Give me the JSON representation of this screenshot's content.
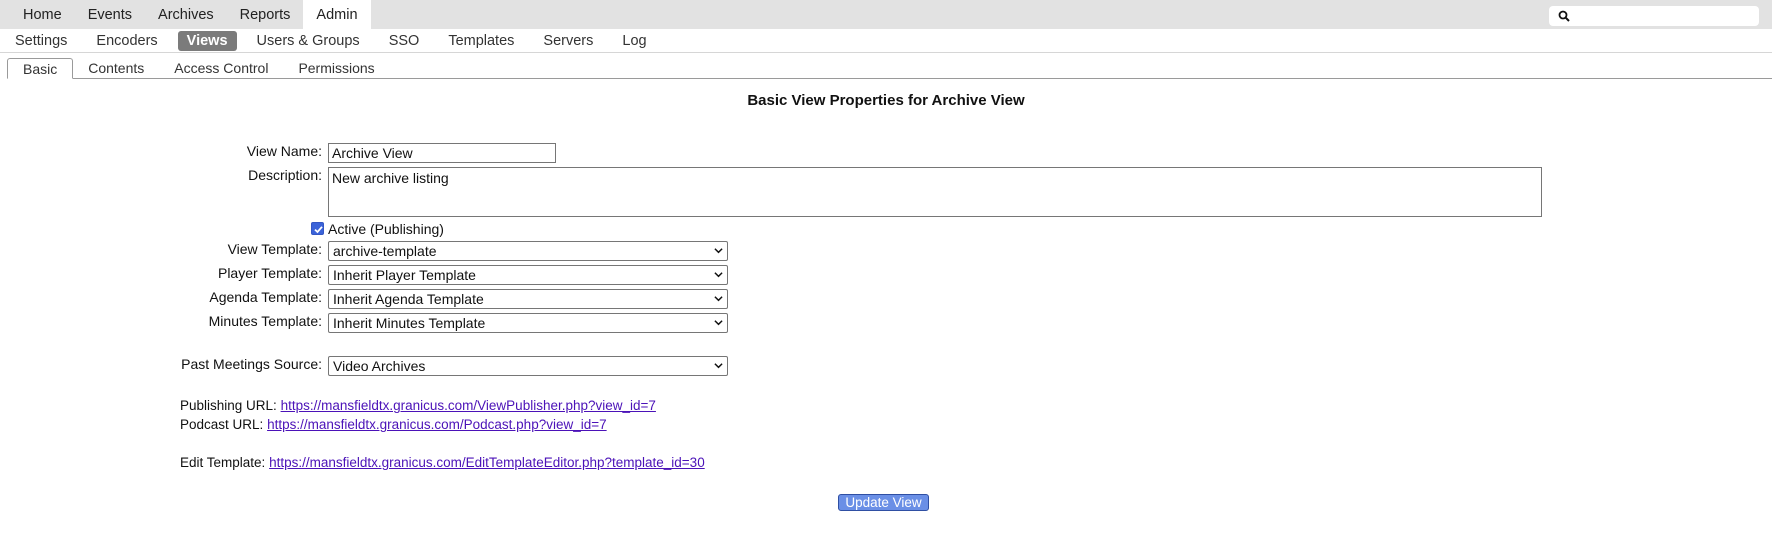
{
  "top_nav": {
    "tabs": [
      {
        "label": "Home"
      },
      {
        "label": "Events"
      },
      {
        "label": "Archives"
      },
      {
        "label": "Reports"
      },
      {
        "label": "Admin",
        "active": true
      }
    ],
    "search": {
      "value": "",
      "icon": "search-icon"
    }
  },
  "sub_nav": {
    "items": [
      {
        "label": "Settings"
      },
      {
        "label": "Encoders"
      },
      {
        "label": "Views",
        "active": true
      },
      {
        "label": "Users & Groups"
      },
      {
        "label": "SSO"
      },
      {
        "label": "Templates"
      },
      {
        "label": "Servers"
      },
      {
        "label": "Log"
      }
    ]
  },
  "page_tabs": [
    {
      "label": "Basic",
      "active": true
    },
    {
      "label": "Contents"
    },
    {
      "label": "Access Control"
    },
    {
      "label": "Permissions"
    }
  ],
  "form": {
    "title": "Basic View Properties for Archive View",
    "view_name": {
      "label": "View Name:",
      "value": "Archive View"
    },
    "description": {
      "label": "Description:",
      "value": "New archive listing"
    },
    "active": {
      "label": "Active (Publishing)",
      "checked": true
    },
    "view_template": {
      "label": "View Template:",
      "value": "archive-template"
    },
    "player_template": {
      "label": "Player Template:",
      "value": "Inherit Player Template"
    },
    "agenda_template": {
      "label": "Agenda Template:",
      "value": "Inherit Agenda Template"
    },
    "minutes_template": {
      "label": "Minutes Template:",
      "value": "Inherit Minutes Template"
    },
    "past_meetings_source": {
      "label": "Past Meetings Source:",
      "value": "Video Archives"
    },
    "publishing_url": {
      "label": "Publishing URL:",
      "url": "https://mansfieldtx.granicus.com/ViewPublisher.php?view_id=7"
    },
    "podcast_url": {
      "label": "Podcast URL:",
      "url": "https://mansfieldtx.granicus.com/Podcast.php?view_id=7"
    },
    "edit_template": {
      "label": "Edit Template:",
      "url": "https://mansfieldtx.granicus.com/EditTemplateEditor.php?template_id=30"
    },
    "submit_label": "Update View"
  },
  "colors": {
    "topbar_bg": "#e2e2e2",
    "active_subnav_bg": "#7b7b7b",
    "link": "#4b12b8",
    "button_bg": "#6a8fe6",
    "checkbox": "#3b63d9"
  }
}
